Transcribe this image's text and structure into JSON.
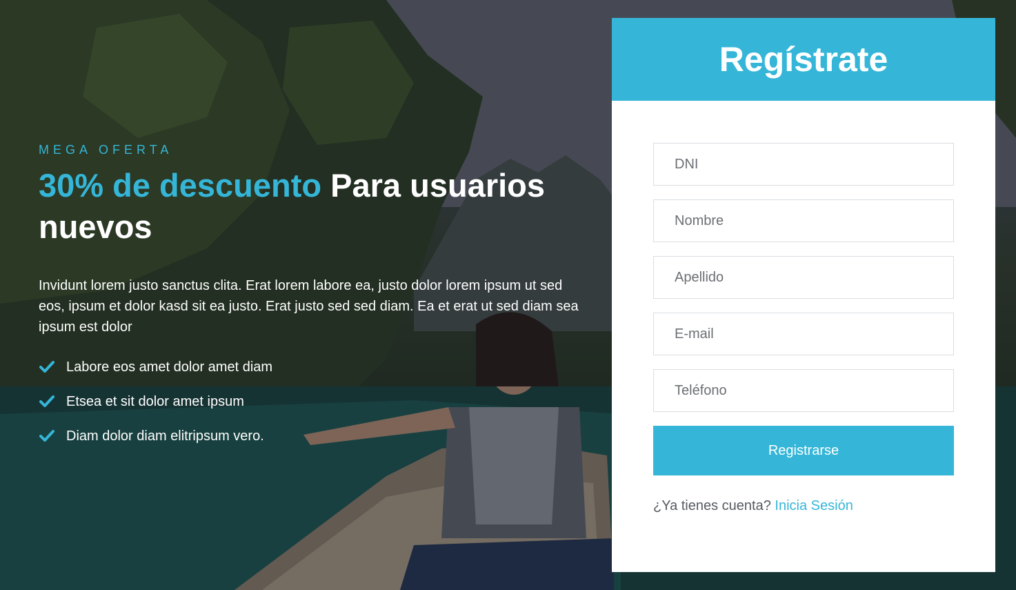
{
  "promo": {
    "eyebrow": "MEGA OFERTA",
    "headline_accent": "30% de descuento",
    "headline_rest": " Para usuarios nuevos",
    "description": "Invidunt lorem justo sanctus clita. Erat lorem labore ea, justo dolor lorem ipsum ut sed eos, ipsum et dolor kasd sit ea justo. Erat justo sed sed diam. Ea et erat ut sed diam sea ipsum est dolor",
    "features": [
      {
        "label": "Labore eos amet dolor amet diam",
        "icon": "check-icon"
      },
      {
        "label": "Etsea et sit dolor amet ipsum",
        "icon": "check-icon"
      },
      {
        "label": "Diam dolor diam elitripsum vero.",
        "icon": "check-icon"
      }
    ]
  },
  "form": {
    "title": "Regístrate",
    "fields": {
      "dni": {
        "placeholder": "DNI",
        "value": ""
      },
      "nombre": {
        "placeholder": "Nombre",
        "value": ""
      },
      "apellido": {
        "placeholder": "Apellido",
        "value": ""
      },
      "email": {
        "placeholder": "E-mail",
        "value": ""
      },
      "telefono": {
        "placeholder": "Teléfono",
        "value": ""
      }
    },
    "submit_label": "Registrarse",
    "login_prompt": "¿Ya tienes cuenta?",
    "login_link": "Inicia Sesión"
  },
  "colors": {
    "accent": "#35b6d8",
    "text_light": "#ffffff",
    "card_bg": "#ffffff"
  }
}
